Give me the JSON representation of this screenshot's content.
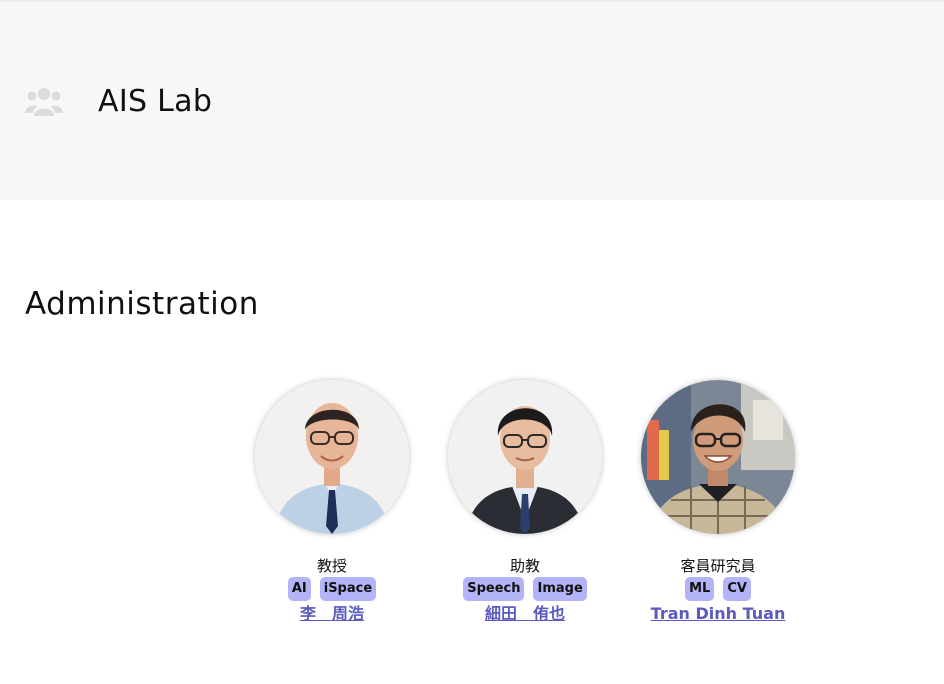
{
  "header": {
    "icon": "users-group-icon",
    "title": "AIS Lab"
  },
  "section": {
    "title": "Administration"
  },
  "members": [
    {
      "role": "教授",
      "tags": [
        "AI",
        "iSpace"
      ],
      "name": "李　周浩"
    },
    {
      "role": "助教",
      "tags": [
        "Speech",
        "Image"
      ],
      "name": "細田　侑也"
    },
    {
      "role": "客員研究員",
      "tags": [
        "ML",
        "CV"
      ],
      "name": "Tran Dinh Tuan"
    }
  ],
  "colors": {
    "header_bg": "#f8f8fa",
    "tag_bg": "#b3b3f7",
    "link": "#5a5abf"
  }
}
